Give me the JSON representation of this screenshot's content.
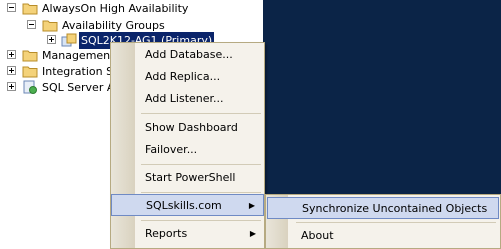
{
  "tree": {
    "items": [
      {
        "label": "AlwaysOn High Availability"
      },
      {
        "label": "Availability Groups"
      },
      {
        "label": "SQL2K12-AG1 (Primary)"
      },
      {
        "label": "Management"
      },
      {
        "label": "Integration Se"
      },
      {
        "label": "SQL Server Ag"
      }
    ]
  },
  "context_menu": {
    "items": [
      {
        "label": "Add Database..."
      },
      {
        "label": "Add Replica..."
      },
      {
        "label": "Add Listener..."
      },
      {
        "label": "Show Dashboard"
      },
      {
        "label": "Failover..."
      },
      {
        "label": "Start PowerShell"
      },
      {
        "label": "SQLskills.com"
      },
      {
        "label": "Reports"
      }
    ]
  },
  "submenu": {
    "items": [
      {
        "label": "Synchronize Uncontained Objects"
      },
      {
        "label": "About"
      }
    ]
  },
  "colors": {
    "selection": "#0a246a",
    "menu_background": "#f5f2eb",
    "menu_highlight": "#cfd9ef",
    "dark_panel": "#0b2447"
  }
}
